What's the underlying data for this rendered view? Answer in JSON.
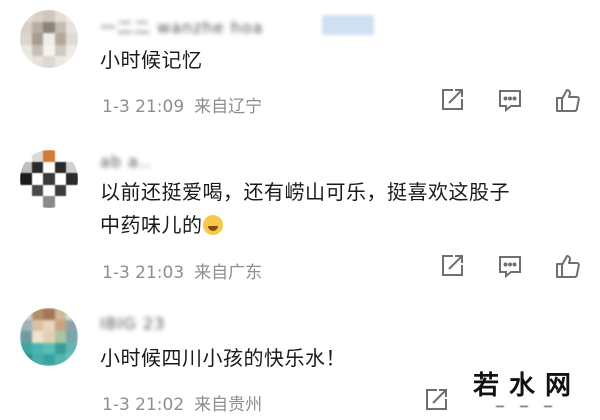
{
  "comments": [
    {
      "username": "一二二 wanzhe hoa",
      "text": "小时候记忆",
      "date": "1-3 21:09",
      "location": "来自辽宁"
    },
    {
      "username": "ab a..",
      "text_line1": "以前还挺爱喝，还有崂山可乐，挺喜欢这股子",
      "text_line2": "中药味儿的",
      "date": "1-3 21:03",
      "location": "来自广东"
    },
    {
      "username": "IBIG 23",
      "text": "小时候四川小孩的快乐水！",
      "date": "1-3 21:02",
      "location": "来自贵州"
    }
  ],
  "icons": [
    "share-icon",
    "comment-icon",
    "like-icon",
    "laugh-emoji-icon"
  ],
  "colors": {
    "meta_text": "#8e8e8e",
    "icon_stroke": "#6f6f6f"
  },
  "watermark": {
    "text": "若水网"
  }
}
